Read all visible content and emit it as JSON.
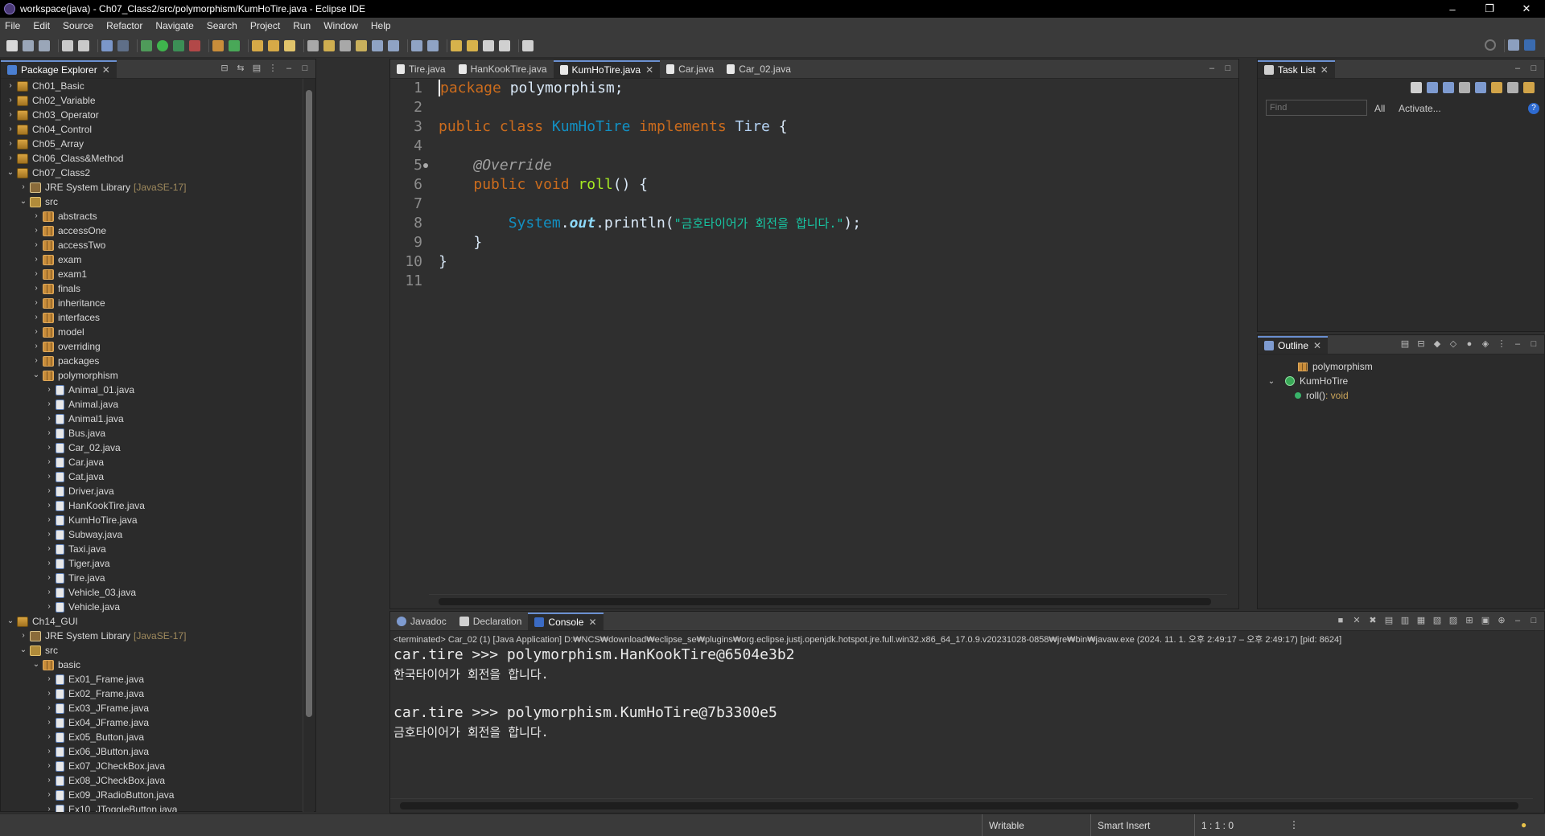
{
  "window": {
    "title": "workspace(java) - Ch07_Class2/src/polymorphism/KumHoTire.java - Eclipse IDE"
  },
  "menu": [
    "File",
    "Edit",
    "Source",
    "Refactor",
    "Navigate",
    "Search",
    "Project",
    "Run",
    "Window",
    "Help"
  ],
  "package_explorer": {
    "title": "Package Explorer",
    "rows": [
      {
        "label": "Ch01_Basic",
        "indent": 0,
        "twisty": "›",
        "icon": "proj"
      },
      {
        "label": "Ch02_Variable",
        "indent": 0,
        "twisty": "›",
        "icon": "proj"
      },
      {
        "label": "Ch03_Operator",
        "indent": 0,
        "twisty": "›",
        "icon": "proj"
      },
      {
        "label": "Ch04_Control",
        "indent": 0,
        "twisty": "›",
        "icon": "proj"
      },
      {
        "label": "Ch05_Array",
        "indent": 0,
        "twisty": "›",
        "icon": "proj"
      },
      {
        "label": "Ch06_Class&Method",
        "indent": 0,
        "twisty": "›",
        "icon": "proj"
      },
      {
        "label": "Ch07_Class2",
        "indent": 0,
        "twisty": "⌄",
        "icon": "proj"
      },
      {
        "label": "JRE System Library",
        "extra": "[JavaSE-17]",
        "indent": 1,
        "twisty": "›",
        "icon": "lib"
      },
      {
        "label": "src",
        "indent": 1,
        "twisty": "⌄",
        "icon": "src"
      },
      {
        "label": "abstracts",
        "indent": 2,
        "twisty": "›",
        "icon": "pkg"
      },
      {
        "label": "accessOne",
        "indent": 2,
        "twisty": "›",
        "icon": "pkg"
      },
      {
        "label": "accessTwo",
        "indent": 2,
        "twisty": "›",
        "icon": "pkg"
      },
      {
        "label": "exam",
        "indent": 2,
        "twisty": "›",
        "icon": "pkg"
      },
      {
        "label": "exam1",
        "indent": 2,
        "twisty": "›",
        "icon": "pkg"
      },
      {
        "label": "finals",
        "indent": 2,
        "twisty": "›",
        "icon": "pkg"
      },
      {
        "label": "inheritance",
        "indent": 2,
        "twisty": "›",
        "icon": "pkg"
      },
      {
        "label": "interfaces",
        "indent": 2,
        "twisty": "›",
        "icon": "pkg"
      },
      {
        "label": "model",
        "indent": 2,
        "twisty": "›",
        "icon": "pkg"
      },
      {
        "label": "overriding",
        "indent": 2,
        "twisty": "›",
        "icon": "pkg"
      },
      {
        "label": "packages",
        "indent": 2,
        "twisty": "›",
        "icon": "pkg"
      },
      {
        "label": "polymorphism",
        "indent": 2,
        "twisty": "⌄",
        "icon": "pkg"
      },
      {
        "label": "Animal_01.java",
        "indent": 3,
        "twisty": "›",
        "icon": "java"
      },
      {
        "label": "Animal.java",
        "indent": 3,
        "twisty": "›",
        "icon": "java"
      },
      {
        "label": "Animal1.java",
        "indent": 3,
        "twisty": "›",
        "icon": "java"
      },
      {
        "label": "Bus.java",
        "indent": 3,
        "twisty": "›",
        "icon": "java"
      },
      {
        "label": "Car_02.java",
        "indent": 3,
        "twisty": "›",
        "icon": "java"
      },
      {
        "label": "Car.java",
        "indent": 3,
        "twisty": "›",
        "icon": "java"
      },
      {
        "label": "Cat.java",
        "indent": 3,
        "twisty": "›",
        "icon": "java"
      },
      {
        "label": "Driver.java",
        "indent": 3,
        "twisty": "›",
        "icon": "java"
      },
      {
        "label": "HanKookTire.java",
        "indent": 3,
        "twisty": "›",
        "icon": "java"
      },
      {
        "label": "KumHoTire.java",
        "indent": 3,
        "twisty": "›",
        "icon": "java"
      },
      {
        "label": "Subway.java",
        "indent": 3,
        "twisty": "›",
        "icon": "java"
      },
      {
        "label": "Taxi.java",
        "indent": 3,
        "twisty": "›",
        "icon": "java"
      },
      {
        "label": "Tiger.java",
        "indent": 3,
        "twisty": "›",
        "icon": "java"
      },
      {
        "label": "Tire.java",
        "indent": 3,
        "twisty": "›",
        "icon": "java"
      },
      {
        "label": "Vehicle_03.java",
        "indent": 3,
        "twisty": "›",
        "icon": "java"
      },
      {
        "label": "Vehicle.java",
        "indent": 3,
        "twisty": "›",
        "icon": "java"
      },
      {
        "label": "Ch14_GUI",
        "indent": 0,
        "twisty": "⌄",
        "icon": "proj"
      },
      {
        "label": "JRE System Library",
        "extra": "[JavaSE-17]",
        "indent": 1,
        "twisty": "›",
        "icon": "lib"
      },
      {
        "label": "src",
        "indent": 1,
        "twisty": "⌄",
        "icon": "src"
      },
      {
        "label": "basic",
        "indent": 2,
        "twisty": "⌄",
        "icon": "pkg"
      },
      {
        "label": "Ex01_Frame.java",
        "indent": 3,
        "twisty": "›",
        "icon": "java"
      },
      {
        "label": "Ex02_Frame.java",
        "indent": 3,
        "twisty": "›",
        "icon": "java"
      },
      {
        "label": "Ex03_JFrame.java",
        "indent": 3,
        "twisty": "›",
        "icon": "java"
      },
      {
        "label": "Ex04_JFrame.java",
        "indent": 3,
        "twisty": "›",
        "icon": "java"
      },
      {
        "label": "Ex05_Button.java",
        "indent": 3,
        "twisty": "›",
        "icon": "java"
      },
      {
        "label": "Ex06_JButton.java",
        "indent": 3,
        "twisty": "›",
        "icon": "java"
      },
      {
        "label": "Ex07_JCheckBox.java",
        "indent": 3,
        "twisty": "›",
        "icon": "java"
      },
      {
        "label": "Ex08_JCheckBox.java",
        "indent": 3,
        "twisty": "›",
        "icon": "java"
      },
      {
        "label": "Ex09_JRadioButton.java",
        "indent": 3,
        "twisty": "›",
        "icon": "java"
      },
      {
        "label": "Ex10_JToggleButton.java",
        "indent": 3,
        "twisty": "›",
        "icon": "java"
      }
    ]
  },
  "editor": {
    "tabs": [
      {
        "label": "Tire.java",
        "active": false
      },
      {
        "label": "HanKookTire.java",
        "active": false
      },
      {
        "label": "KumHoTire.java",
        "active": true
      },
      {
        "label": "Car.java",
        "active": false
      },
      {
        "label": "Car_02.java",
        "active": false
      }
    ],
    "line_numbers": [
      "1",
      "2",
      "3",
      "4",
      "5",
      "6",
      "7",
      "8",
      "9",
      "10",
      "11"
    ],
    "code": {
      "l1_kw": "package",
      "l1_rest": " polymorphism;",
      "l3_kw1": "public",
      "l3_kw2": "class",
      "l3_name": "KumHoTire",
      "l3_kw3": "implements",
      "l3_type": "Tire",
      "l3_brace": " {",
      "l5_ann": "@Override",
      "l6_kw1": "public",
      "l6_kw2": "void",
      "l6_fn": "roll",
      "l6_rest": "() {",
      "l8_sys": "System",
      "l8_dot1": ".",
      "l8_out": "out",
      "l8_println": ".println(",
      "l8_str": "\"금호타이어가 회전을 합니다.\"",
      "l8_end": ");",
      "l9": "}",
      "l10": "}"
    }
  },
  "task_list": {
    "title": "Task List",
    "find_placeholder": "Find",
    "all_label": "All",
    "activate_label": "Activate..."
  },
  "outline": {
    "title": "Outline",
    "package": "polymorphism",
    "class": "KumHoTire",
    "method": "roll()",
    "method_type": " : void"
  },
  "console": {
    "tabs": [
      {
        "label": "Javadoc",
        "active": false
      },
      {
        "label": "Declaration",
        "active": false
      },
      {
        "label": "Console",
        "active": true
      }
    ],
    "info": "<terminated> Car_02 (1) [Java Application] D:₩NCS₩download₩eclipse_se₩plugins₩org.eclipse.justj.openjdk.hotspot.jre.full.win32.x86_64_17.0.9.v20231028-0858₩jre₩bin₩javaw.exe  (2024. 11. 1. 오후 2:49:17 – 오후 2:49:17) [pid: 8624]",
    "lines": [
      "car.tire >>> polymorphism.HanKookTire@6504e3b2",
      "한국타이어가 회전을 합니다.",
      "",
      "car.tire >>> polymorphism.KumHoTire@7b3300e5",
      "금호타이어가 회전을 합니다."
    ]
  },
  "status": {
    "writable": "Writable",
    "insert_mode": "Smart Insert",
    "position": "1 : 1 : 0"
  }
}
